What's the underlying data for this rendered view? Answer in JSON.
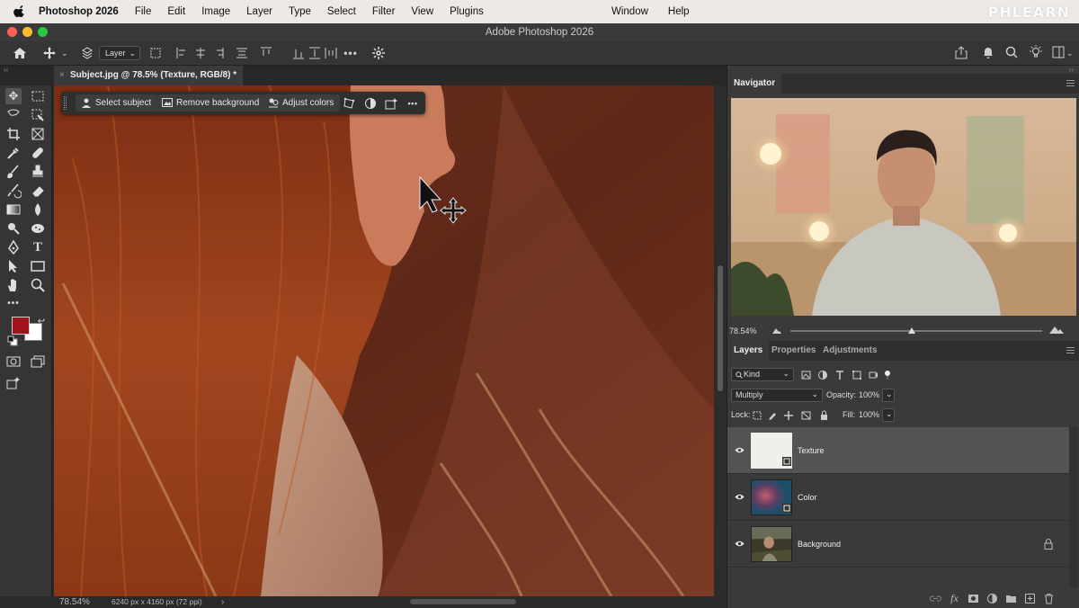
{
  "menubar": {
    "app": "Photoshop 2026",
    "items": [
      "File",
      "Edit",
      "Image",
      "Layer",
      "Type",
      "Select",
      "Filter",
      "View",
      "Plugins"
    ],
    "right_items": [
      "Window",
      "Help"
    ],
    "brand": "PHLEARN"
  },
  "window": {
    "title": "Adobe Photoshop 2026"
  },
  "options": {
    "layer_select": "Layer"
  },
  "document": {
    "tab": "Subject.jpg @ 78.5% (Texture, RGB/8) *"
  },
  "taskbar": {
    "select_subject": "Select subject",
    "remove_background": "Remove background",
    "adjust_colors": "Adjust colors"
  },
  "status": {
    "zoom": "78.54%",
    "doc_size": "6240 px x 4160 px (72 ppi)",
    "arrow": "›"
  },
  "colors": {
    "foreground": "#a0131d",
    "background": "#ffffff",
    "ui_bg": "#353535",
    "panel_bg": "#3a3a3a"
  },
  "navigator": {
    "title": "Navigator",
    "zoom": "78.54%"
  },
  "layers_panel": {
    "tabs": [
      "Layers",
      "Properties",
      "Adjustments"
    ],
    "kind_filter": "Kind",
    "blend_mode": "Multiply",
    "opacity_label": "Opacity:",
    "opacity_value": "100%",
    "lock_label": "Lock:",
    "fill_label": "Fill:",
    "fill_value": "100%",
    "layers": [
      {
        "name": "Texture",
        "selected": true
      },
      {
        "name": "Color",
        "selected": false
      },
      {
        "name": "Background",
        "selected": false,
        "locked": true
      }
    ],
    "footer_icons": [
      "link-icon",
      "fx-icon",
      "mask-icon",
      "adjustment-icon",
      "group-icon",
      "new-layer-icon",
      "trash-icon"
    ],
    "fx_label": "fx"
  }
}
